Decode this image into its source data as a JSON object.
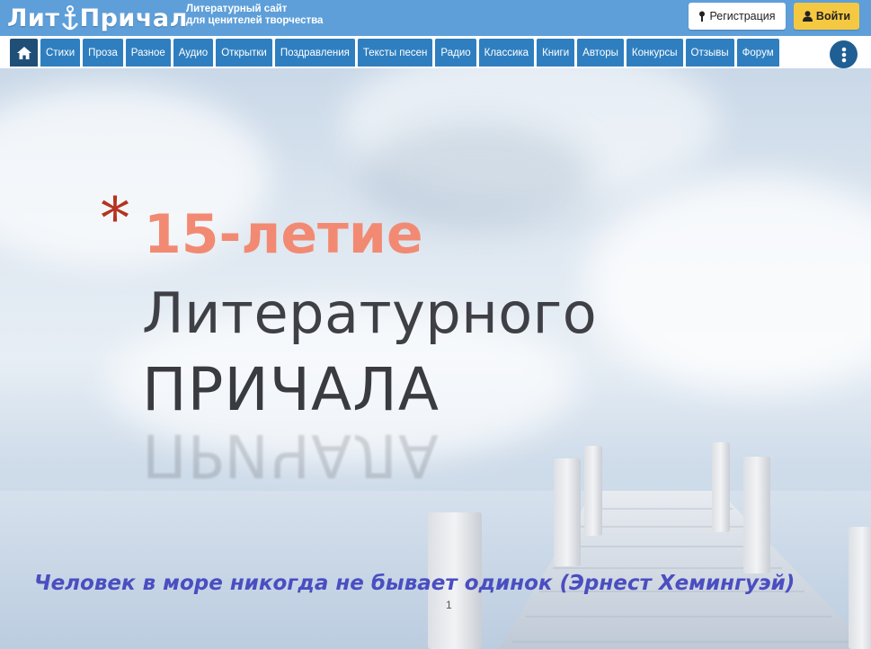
{
  "header": {
    "logo_left": "Лит",
    "logo_right": "Причал",
    "tagline_line1": "Литературный сайт",
    "tagline_line2": "для ценителей творчества",
    "register_label": "Регистрация",
    "login_label": "Войти",
    "bg_color": "#5e9fd9",
    "login_color": "#f5c842"
  },
  "nav": {
    "home_icon": "home-icon",
    "items": [
      "Стихи",
      "Проза",
      "Разное",
      "Аудио",
      "Открытки",
      "Поздравления",
      "Тексты песен",
      "Радио",
      "Классика",
      "Книги",
      "Авторы",
      "Конкурсы",
      "Отзывы",
      "Форум"
    ],
    "more_icon": "vertical-dots-icon",
    "item_color": "#2f7fc0"
  },
  "slide": {
    "bullet": "*",
    "title_line1": "15-летие",
    "title_line2": "Литературного",
    "title_line3": "ПРИЧАЛА",
    "quote": "Человек в море никогда не бывает одинок (Эрнест Хемингуэй)",
    "page_number": "1",
    "accent_color": "#f28a73",
    "quote_color": "#4a4ec0"
  }
}
